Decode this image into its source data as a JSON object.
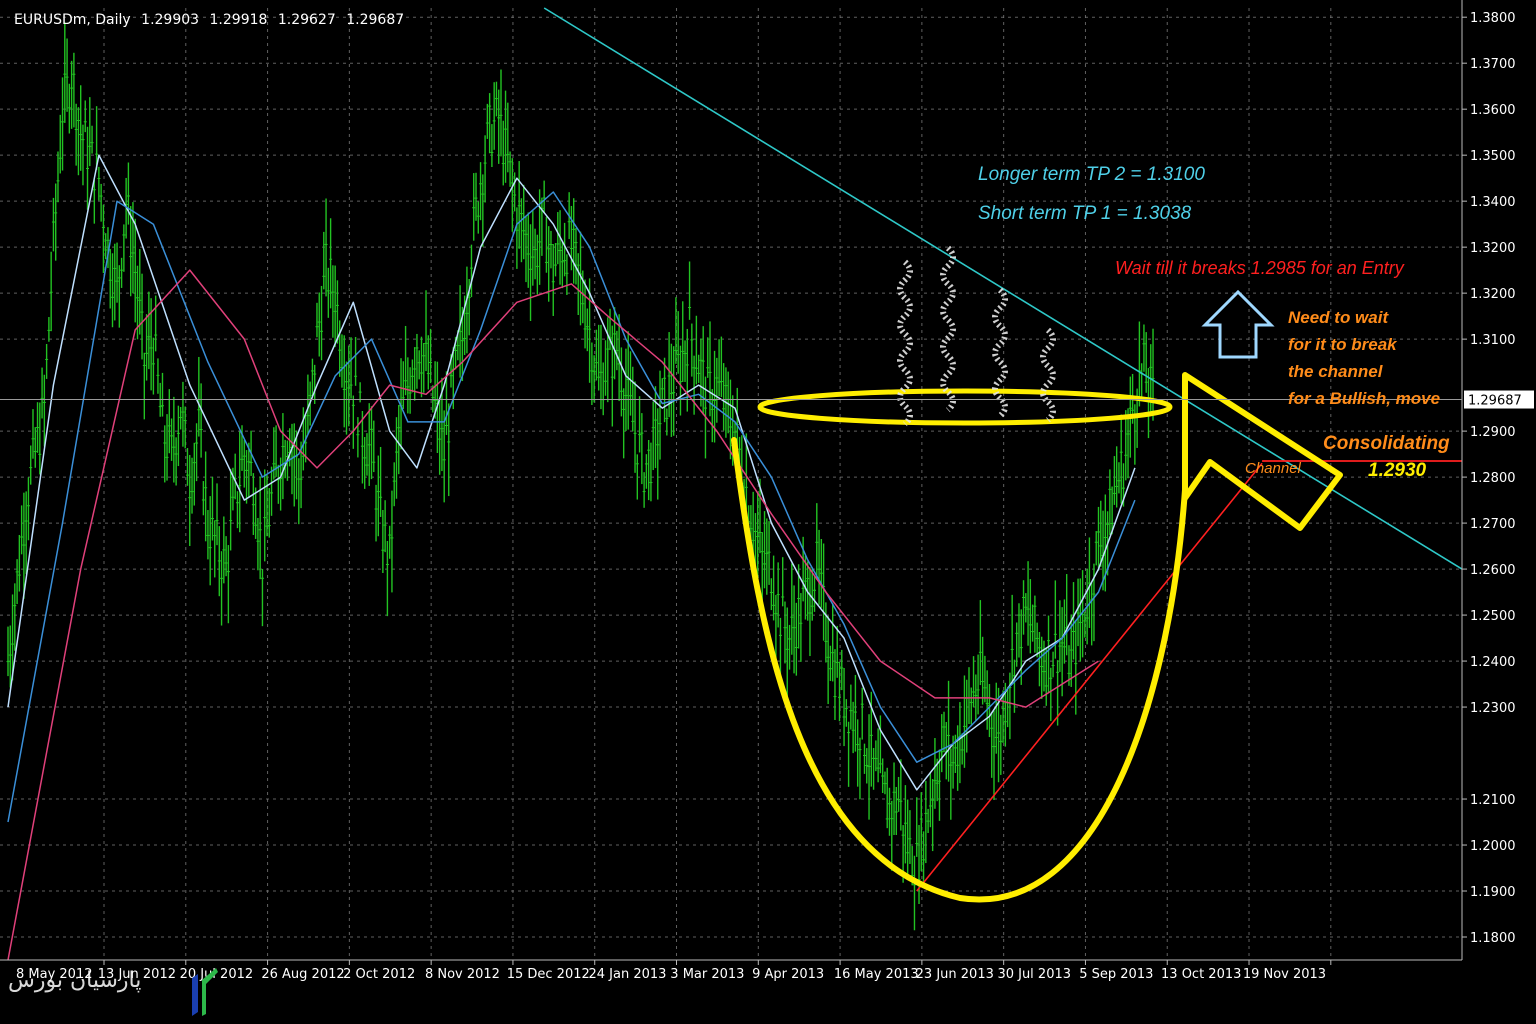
{
  "header": {
    "symbol": "EURUSDm, Daily",
    "open": "1.29903",
    "high": "1.29918",
    "low": "1.29627",
    "close": "1.29687"
  },
  "watermark": {
    "text": "پارسیان بورس"
  },
  "colors": {
    "background": "#000000",
    "grid": "#7a7a7a",
    "candles": "#22c322",
    "ma_fast": "#bfe0ff",
    "ma_mid": "#3a8fd8",
    "ma_slow": "#e0407a",
    "trendline": "#2ec8c8",
    "support": "#ff2020",
    "annotation": "#ffee00",
    "tp_text": "#4fd0e8",
    "entry_text": "#ff2020",
    "wait_text": "#ff8c1a",
    "arrow": "#9fd8ff"
  },
  "chart_data": {
    "type": "candlestick",
    "title": "",
    "xlabel": "",
    "ylabel": "",
    "ylim": [
      1.175,
      1.382
    ],
    "y_ticks": [
      "1.3800",
      "1.3700",
      "1.3600",
      "1.3500",
      "1.3400",
      "1.3200",
      "1.3200",
      "1.3100",
      "1.2900",
      "1.2800",
      "1.2700",
      "1.2600",
      "1.2500",
      "1.2400",
      "1.2300",
      "1.2100",
      "1.2000",
      "1.1900",
      "1.1800"
    ],
    "y_tick_values": [
      1.38,
      1.37,
      1.36,
      1.35,
      1.34,
      1.33,
      1.32,
      1.31,
      1.29,
      1.28,
      1.27,
      1.26,
      1.25,
      1.24,
      1.23,
      1.21,
      1.2,
      1.19,
      1.18
    ],
    "x_ticks": [
      "8 May 2012",
      "13 Jun 2012",
      "20 Jul 2012",
      "26 Aug 2012",
      "2 Oct 2012",
      "8 Nov 2012",
      "15 Dec 2012",
      "24 Jan 2013",
      "3 Mar 2013",
      "9 Apr 2013",
      "16 May 2013",
      "23 Jun 2013",
      "30 Jul 2013",
      "5 Sep 2013",
      "13 Oct 2013",
      "19 Nov 2013"
    ],
    "x_index_range": [
      0,
      160
    ],
    "x_tick_index": [
      0,
      9,
      18,
      27,
      36,
      45,
      54,
      63,
      72,
      81,
      90,
      99,
      108,
      117,
      126,
      135
    ],
    "current_price": {
      "label": "1.29687",
      "value": 1.29687
    },
    "close_path": [
      [
        0,
        1.24
      ],
      [
        2,
        1.275
      ],
      [
        4,
        1.295
      ],
      [
        5,
        1.33
      ],
      [
        6,
        1.36
      ],
      [
        7,
        1.368
      ],
      [
        8,
        1.355
      ],
      [
        10,
        1.345
      ],
      [
        11,
        1.33
      ],
      [
        12,
        1.32
      ],
      [
        13,
        1.34
      ],
      [
        14,
        1.325
      ],
      [
        15,
        1.305
      ],
      [
        16,
        1.31
      ],
      [
        17,
        1.29
      ],
      [
        18,
        1.285
      ],
      [
        19,
        1.295
      ],
      [
        20,
        1.28
      ],
      [
        21,
        1.29
      ],
      [
        22,
        1.27
      ],
      [
        23,
        1.265
      ],
      [
        24,
        1.26
      ],
      [
        25,
        1.275
      ],
      [
        26,
        1.285
      ],
      [
        27,
        1.28
      ],
      [
        28,
        1.262
      ],
      [
        29,
        1.275
      ],
      [
        30,
        1.285
      ],
      [
        31,
        1.29
      ],
      [
        32,
        1.28
      ],
      [
        33,
        1.29
      ],
      [
        34,
        1.31
      ],
      [
        35,
        1.325
      ],
      [
        36,
        1.32
      ],
      [
        37,
        1.305
      ],
      [
        38,
        1.3
      ],
      [
        39,
        1.29
      ],
      [
        40,
        1.285
      ],
      [
        41,
        1.27
      ],
      [
        42,
        1.262
      ],
      [
        43,
        1.29
      ],
      [
        44,
        1.3
      ],
      [
        45,
        1.31
      ],
      [
        46,
        1.305
      ],
      [
        47,
        1.295
      ],
      [
        48,
        1.285
      ],
      [
        49,
        1.3
      ],
      [
        50,
        1.31
      ],
      [
        51,
        1.33
      ],
      [
        52,
        1.345
      ],
      [
        53,
        1.355
      ],
      [
        54,
        1.358
      ],
      [
        55,
        1.348
      ],
      [
        56,
        1.338
      ],
      [
        57,
        1.332
      ],
      [
        58,
        1.328
      ],
      [
        59,
        1.335
      ],
      [
        60,
        1.325
      ],
      [
        61,
        1.33
      ],
      [
        62,
        1.33
      ],
      [
        63,
        1.322
      ],
      [
        64,
        1.312
      ],
      [
        65,
        1.3
      ],
      [
        66,
        1.305
      ],
      [
        67,
        1.308
      ],
      [
        68,
        1.298
      ],
      [
        69,
        1.29
      ],
      [
        70,
        1.282
      ],
      [
        71,
        1.285
      ],
      [
        72,
        1.295
      ],
      [
        73,
        1.3
      ],
      [
        74,
        1.305
      ],
      [
        75,
        1.312
      ],
      [
        76,
        1.305
      ],
      [
        77,
        1.298
      ],
      [
        78,
        1.3
      ],
      [
        79,
        1.295
      ],
      [
        80,
        1.29
      ],
      [
        81,
        1.28
      ],
      [
        82,
        1.27
      ],
      [
        83,
        1.262
      ],
      [
        84,
        1.26
      ],
      [
        85,
        1.25
      ],
      [
        86,
        1.245
      ],
      [
        87,
        1.25
      ],
      [
        88,
        1.255
      ],
      [
        89,
        1.26
      ],
      [
        90,
        1.248
      ],
      [
        91,
        1.238
      ],
      [
        92,
        1.232
      ],
      [
        93,
        1.228
      ],
      [
        94,
        1.225
      ],
      [
        95,
        1.218
      ],
      [
        96,
        1.212
      ],
      [
        97,
        1.208
      ],
      [
        98,
        1.21
      ],
      [
        99,
        1.2
      ],
      [
        100,
        1.196
      ],
      [
        101,
        1.205
      ],
      [
        102,
        1.215
      ],
      [
        103,
        1.222
      ],
      [
        104,
        1.218
      ],
      [
        105,
        1.225
      ],
      [
        106,
        1.232
      ],
      [
        107,
        1.236
      ],
      [
        108,
        1.23
      ],
      [
        109,
        1.222
      ],
      [
        110,
        1.235
      ],
      [
        111,
        1.245
      ],
      [
        112,
        1.25
      ],
      [
        113,
        1.246
      ],
      [
        114,
        1.24
      ],
      [
        115,
        1.242
      ],
      [
        116,
        1.244
      ],
      [
        117,
        1.24
      ],
      [
        118,
        1.248
      ],
      [
        119,
        1.255
      ],
      [
        120,
        1.265
      ],
      [
        121,
        1.27
      ],
      [
        122,
        1.278
      ],
      [
        123,
        1.285
      ],
      [
        124,
        1.298
      ],
      [
        125,
        1.303
      ],
      [
        126,
        1.297
      ]
    ],
    "series": [
      {
        "key": "ma_fast",
        "values": [
          [
            0,
            1.23
          ],
          [
            5,
            1.3
          ],
          [
            10,
            1.35
          ],
          [
            14,
            1.335
          ],
          [
            20,
            1.3
          ],
          [
            26,
            1.275
          ],
          [
            30,
            1.28
          ],
          [
            34,
            1.3
          ],
          [
            38,
            1.318
          ],
          [
            42,
            1.29
          ],
          [
            45,
            1.282
          ],
          [
            48,
            1.3
          ],
          [
            52,
            1.33
          ],
          [
            56,
            1.345
          ],
          [
            60,
            1.335
          ],
          [
            64,
            1.32
          ],
          [
            68,
            1.302
          ],
          [
            72,
            1.295
          ],
          [
            76,
            1.3
          ],
          [
            80,
            1.295
          ],
          [
            84,
            1.27
          ],
          [
            88,
            1.255
          ],
          [
            92,
            1.245
          ],
          [
            96,
            1.225
          ],
          [
            100,
            1.212
          ],
          [
            104,
            1.222
          ],
          [
            108,
            1.228
          ],
          [
            112,
            1.24
          ],
          [
            116,
            1.245
          ],
          [
            120,
            1.26
          ],
          [
            124,
            1.282
          ]
        ]
      },
      {
        "key": "ma_mid",
        "values": [
          [
            0,
            1.205
          ],
          [
            6,
            1.27
          ],
          [
            12,
            1.34
          ],
          [
            16,
            1.335
          ],
          [
            22,
            1.305
          ],
          [
            28,
            1.28
          ],
          [
            32,
            1.285
          ],
          [
            36,
            1.302
          ],
          [
            40,
            1.31
          ],
          [
            44,
            1.292
          ],
          [
            48,
            1.292
          ],
          [
            52,
            1.312
          ],
          [
            56,
            1.335
          ],
          [
            60,
            1.342
          ],
          [
            64,
            1.33
          ],
          [
            68,
            1.31
          ],
          [
            72,
            1.296
          ],
          [
            76,
            1.298
          ],
          [
            80,
            1.292
          ],
          [
            84,
            1.28
          ],
          [
            88,
            1.262
          ],
          [
            92,
            1.248
          ],
          [
            96,
            1.23
          ],
          [
            100,
            1.218
          ],
          [
            104,
            1.222
          ],
          [
            108,
            1.23
          ],
          [
            112,
            1.238
          ],
          [
            116,
            1.245
          ],
          [
            120,
            1.255
          ],
          [
            124,
            1.275
          ]
        ]
      },
      {
        "key": "ma_slow",
        "values": [
          [
            0,
            1.175
          ],
          [
            8,
            1.26
          ],
          [
            14,
            1.312
          ],
          [
            20,
            1.325
          ],
          [
            26,
            1.31
          ],
          [
            30,
            1.29
          ],
          [
            34,
            1.282
          ],
          [
            38,
            1.29
          ],
          [
            42,
            1.3
          ],
          [
            46,
            1.298
          ],
          [
            50,
            1.305
          ],
          [
            56,
            1.318
          ],
          [
            62,
            1.322
          ],
          [
            66,
            1.315
          ],
          [
            72,
            1.305
          ],
          [
            78,
            1.29
          ],
          [
            84,
            1.272
          ],
          [
            90,
            1.255
          ],
          [
            96,
            1.24
          ],
          [
            102,
            1.232
          ],
          [
            108,
            1.232
          ],
          [
            112,
            1.23
          ],
          [
            116,
            1.235
          ],
          [
            120,
            1.24
          ]
        ]
      }
    ],
    "trendline": {
      "from": [
        59,
        1.382
      ],
      "to": [
        160,
        1.26
      ]
    },
    "support_line": {
      "from": [
        100,
        1.19
      ],
      "to": [
        138,
        1.283
      ]
    },
    "support_level": {
      "value": 1.2835
    },
    "annotations": {
      "tp2": "Longer term TP 2 = 1.3100",
      "tp1": "Short term TP 1 = 1.3038",
      "entry": "Wait till it breaks 1.2985 for an Entry",
      "wait_lines": [
        "Need to wait",
        "for it to break",
        "the channel",
        "for a Bullish, move"
      ],
      "channel": "Channel",
      "consolidating": "Consolidating",
      "level": "1.2930"
    }
  }
}
